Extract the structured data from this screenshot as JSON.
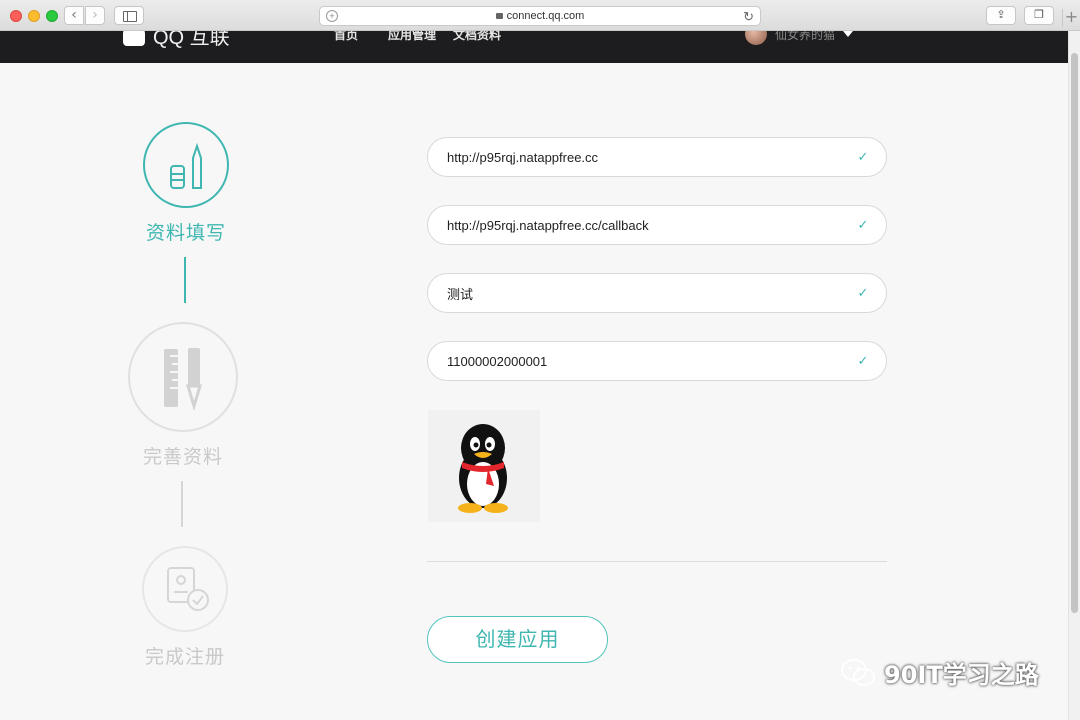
{
  "browser": {
    "url": "connect.qq.com"
  },
  "header": {
    "logo_text": "QQ 互联",
    "nav": [
      "首页",
      "应用管理",
      "文档资料"
    ],
    "user_name": "仙女养的猫"
  },
  "steps": [
    {
      "label": "资料填写",
      "state": "active"
    },
    {
      "label": "完善资料",
      "state": "inactive"
    },
    {
      "label": "完成注册",
      "state": "inactive"
    }
  ],
  "form": {
    "fields": [
      {
        "value": "http://p95rqj.natappfree.cc"
      },
      {
        "value": "http://p95rqj.natappfree.cc/callback"
      },
      {
        "value": "测试"
      },
      {
        "value": "11000002000001"
      }
    ],
    "submit_label": "创建应用"
  },
  "watermark": {
    "text": "90IT学习之路"
  },
  "colors": {
    "accent": "#3fb7b0",
    "inactive": "#cfcfcf",
    "header_bg": "#1d1d1f"
  }
}
